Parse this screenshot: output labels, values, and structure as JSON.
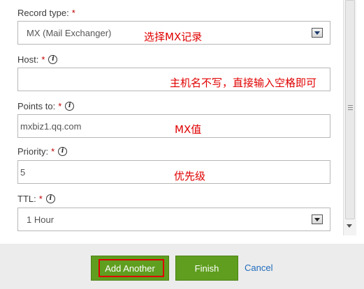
{
  "form": {
    "record_type": {
      "label": "Record type:",
      "required_mark": "*",
      "value": "MX (Mail Exchanger)",
      "note": "选择MX记录"
    },
    "host": {
      "label": "Host:",
      "required_mark": "*",
      "value": "",
      "note": "主机名不写，直接输入空格即可"
    },
    "points_to": {
      "label": "Points to:",
      "required_mark": "*",
      "value": "mxbiz1.qq.com",
      "note": "MX值"
    },
    "priority": {
      "label": "Priority:",
      "required_mark": "*",
      "value": "5",
      "note": "优先级"
    },
    "ttl": {
      "label": "TTL:",
      "required_mark": "*",
      "value": "1 Hour"
    },
    "info_icon_glyph": "i"
  },
  "footer": {
    "add_another_label": "Add Another",
    "finish_label": "Finish",
    "cancel_label": "Cancel"
  },
  "colors": {
    "button_green": "#5f9e1f",
    "required_red": "#c00000",
    "annotation_red": "#e00000",
    "link_blue": "#1f6bbd"
  },
  "icons": [
    "info-icon",
    "dropdown-arrow-icon",
    "scroll-down-arrow-icon"
  ]
}
